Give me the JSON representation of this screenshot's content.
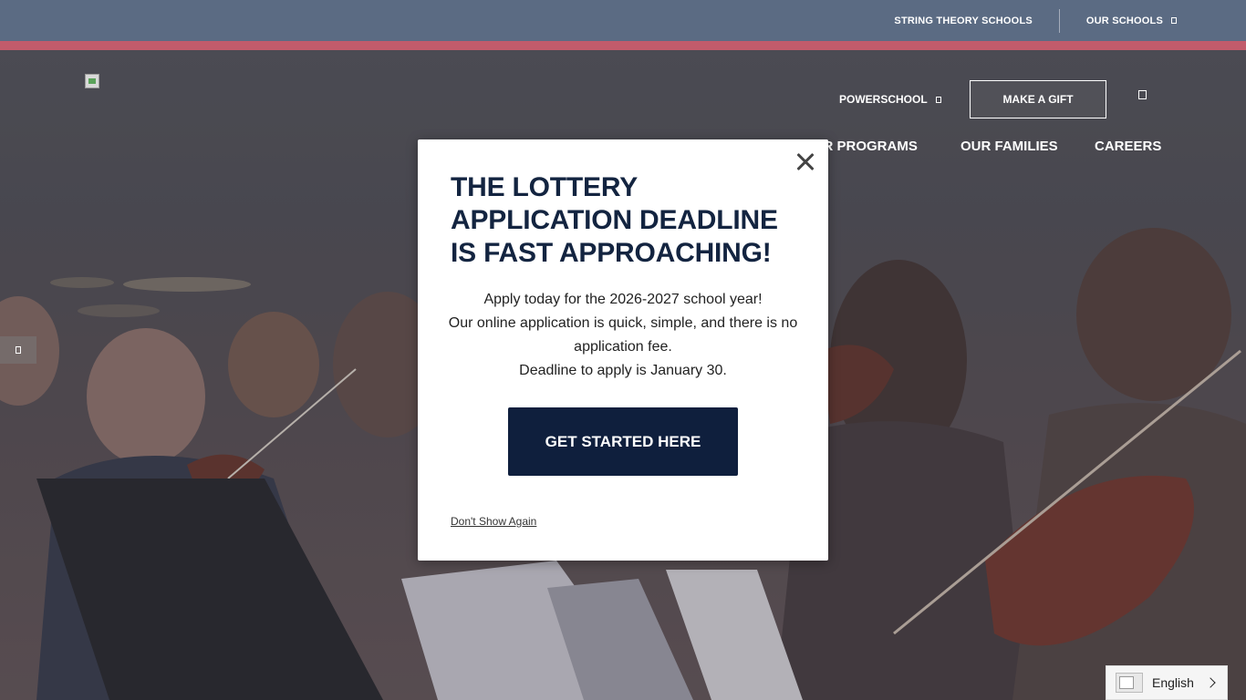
{
  "utility_bar": {
    "string_theory_label": "STRING THEORY SCHOOLS",
    "our_schools_label": "OUR SCHOOLS"
  },
  "header": {
    "powerschool_label": "POWERSCHOOL",
    "make_gift_label": "MAKE A GIFT"
  },
  "nav": {
    "items": [
      {
        "label": "OUR PROGRAMS"
      },
      {
        "label": "OUR FAMILIES"
      },
      {
        "label": "CAREERS"
      }
    ]
  },
  "modal": {
    "title": "THE LOTTERY APPLICATION DEADLINE IS FAST APPROACHING!",
    "body_lines": [
      "Apply today for the 2026-2027 school year!",
      "Our online application is quick, simple, and there is no application fee.",
      "Deadline to apply is January 30."
    ],
    "cta_label": "GET STARTED HERE",
    "dont_show_label": "Don't Show Again"
  },
  "language": {
    "selected": "English"
  },
  "colors": {
    "utility_bar": "#5b6b83",
    "accent_stripe": "#c25b6b",
    "modal_title": "#132440",
    "cta_bg": "#0f1f3d"
  }
}
